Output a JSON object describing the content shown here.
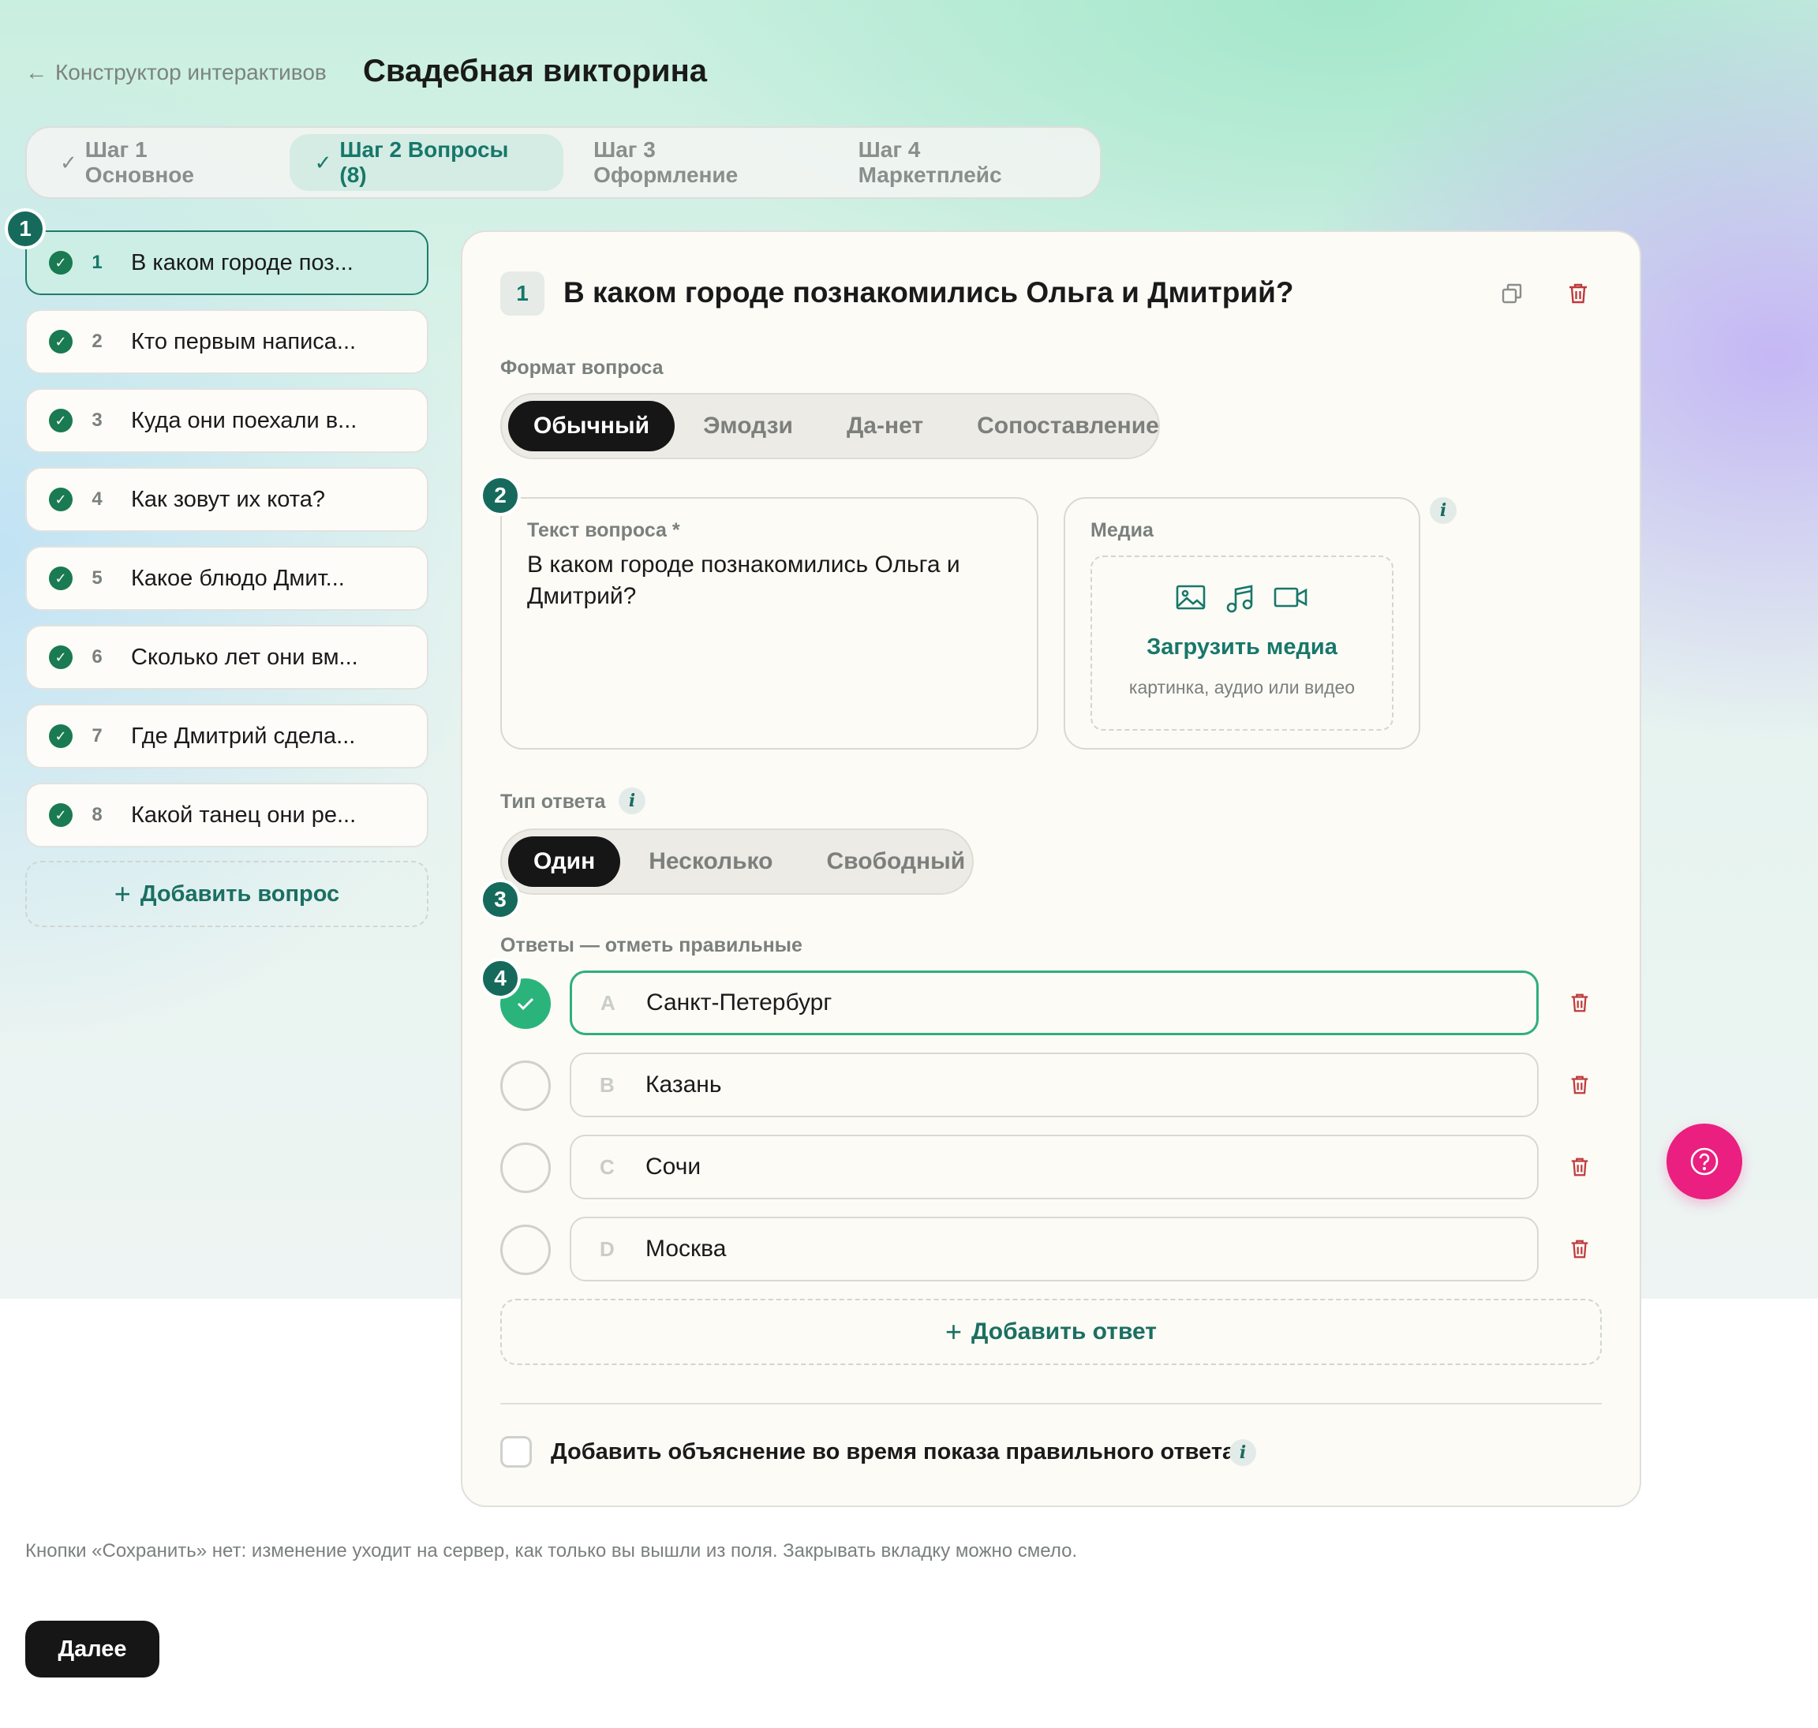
{
  "header": {
    "back_label": "Конструктор интерактивов",
    "title": "Свадебная викторина"
  },
  "steps": [
    {
      "label": "Шаг 1  Основное",
      "done": true
    },
    {
      "label": "Шаг 2  Вопросы (8)",
      "done": true,
      "active": true
    },
    {
      "label": "Шаг 3  Оформление"
    },
    {
      "label": "Шаг 4  Маркетплейс"
    }
  ],
  "questions": [
    {
      "num": "1",
      "text": "В каком городе поз..."
    },
    {
      "num": "2",
      "text": "Кто первым написа..."
    },
    {
      "num": "3",
      "text": "Куда они поехали в..."
    },
    {
      "num": "4",
      "text": "Как зовут их кота?"
    },
    {
      "num": "5",
      "text": "Какое блюдо Дмит..."
    },
    {
      "num": "6",
      "text": "Сколько лет они вм..."
    },
    {
      "num": "7",
      "text": "Где Дмитрий сдела..."
    },
    {
      "num": "8",
      "text": "Какой танец они ре..."
    }
  ],
  "add_question_label": "Добавить вопрос",
  "markers": [
    "1",
    "2",
    "3",
    "4"
  ],
  "editor": {
    "number": "1",
    "title": "В каком городе познакомились Ольга и Дмитрий?",
    "format_label": "Формат вопроса",
    "formats": [
      "Обычный",
      "Эмодзи",
      "Да-нет",
      "Сопоставление"
    ],
    "selected_format": "Обычный",
    "text_label": "Текст вопроса *",
    "text_value": "В каком городе познакомились Ольга и Дмитрий?",
    "media_label": "Медиа",
    "upload_label": "Загрузить медиа",
    "upload_hint": "картинка, аудио или видео",
    "answer_type_label": "Тип ответа",
    "answer_types": [
      "Один",
      "Несколько",
      "Свободный"
    ],
    "selected_answer_type": "Один",
    "answers_label": "Ответы — отметь правильные",
    "answers": [
      {
        "letter": "A",
        "text": "Санкт-Петербург",
        "correct": true
      },
      {
        "letter": "B",
        "text": "Казань",
        "correct": false
      },
      {
        "letter": "C",
        "text": "Сочи",
        "correct": false
      },
      {
        "letter": "D",
        "text": "Москва",
        "correct": false
      }
    ],
    "add_answer_label": "Добавить ответ",
    "explanation_label": "Добавить объяснение во время показа правильного ответа",
    "explanation_checked": false
  },
  "note": "Кнопки «Сохранить» нет: изменение уходит на сервер, как только вы вышли из поля. Закрывать вкладку можно смело.",
  "next_label": "Далее",
  "colors": {
    "accent": "#17776a",
    "correct": "#2ab47c",
    "delete": "#c0393b",
    "help": "#ea1f7f",
    "dark": "#161616"
  }
}
